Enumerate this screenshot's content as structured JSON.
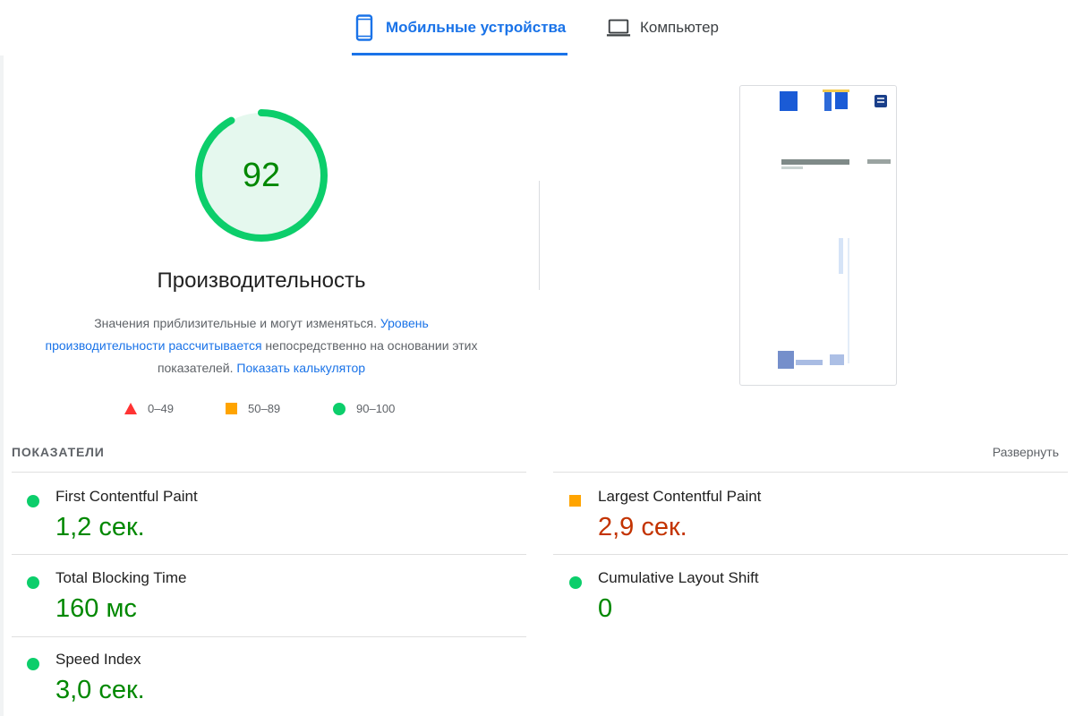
{
  "tabs": {
    "mobile": {
      "label": "Мобильные устройства",
      "icon": "smartphone-icon",
      "active": true
    },
    "desktop": {
      "label": "Компьютер",
      "icon": "laptop-icon",
      "active": false
    }
  },
  "gauge": {
    "score": "92",
    "score_value": 92,
    "title": "Производительность",
    "color": "#0cce6b",
    "fill_color": "#e5f8ee",
    "text_color": "#008800"
  },
  "description": {
    "part1": "Значения приблизительные и могут изменяться. ",
    "link1": "Уровень производительности рассчитывается",
    "part2": " непосредственно на основании этих показателей. ",
    "link2": "Показать калькулятор"
  },
  "legend": {
    "fail": "0–49",
    "average": "50–89",
    "pass": "90–100"
  },
  "metrics_section": {
    "title": "ПОКАЗАТЕЛИ",
    "expand": "Развернуть"
  },
  "metrics": {
    "fcp": {
      "name": "First Contentful Paint",
      "value": "1,2 сек.",
      "status": "pass"
    },
    "lcp": {
      "name": "Largest Contentful Paint",
      "value": "2,9 сек.",
      "status": "average"
    },
    "tbt": {
      "name": "Total Blocking Time",
      "value": "160 мс",
      "status": "pass"
    },
    "cls": {
      "name": "Cumulative Layout Shift",
      "value": "0",
      "status": "pass"
    },
    "si": {
      "name": "Speed Index",
      "value": "3,0 сек.",
      "status": "pass"
    }
  },
  "colors": {
    "accent": "#1a73e8",
    "pass": "#0cce6b",
    "average": "#ffa400",
    "fail": "#ff3333",
    "pass_text": "#008800",
    "average_text": "#c33300"
  }
}
